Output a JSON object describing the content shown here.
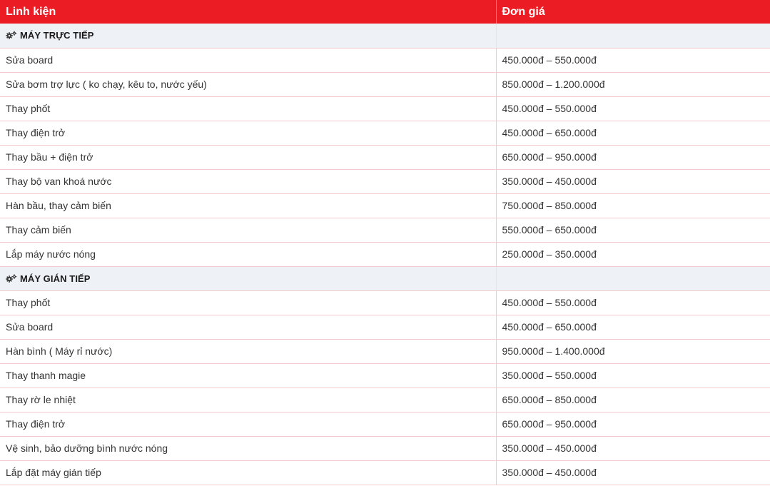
{
  "table": {
    "headers": {
      "item": "Linh kiện",
      "price": "Đơn giá"
    },
    "colors": {
      "header_bg": "#ec1c24",
      "section_bg": "#eef1f5",
      "row_border": "#f3c9cb"
    },
    "sections": [
      {
        "icon": "gears-icon",
        "title": "MÁY TRỰC TIẾP",
        "rows": [
          {
            "item": "Sửa board",
            "price": "450.000đ – 550.000đ"
          },
          {
            "item": "Sửa bơm trợ lực ( ko chạy, kêu to, nước yếu)",
            "price": "850.000đ – 1.200.000đ"
          },
          {
            "item": "Thay phốt",
            "price": "450.000đ – 550.000đ"
          },
          {
            "item": "Thay điện trở",
            "price": "450.000đ – 650.000đ"
          },
          {
            "item": "Thay bầu + điện trở",
            "price": "650.000đ – 950.000đ"
          },
          {
            "item": "Thay bộ van khoá nước",
            "price": "350.000đ – 450.000đ"
          },
          {
            "item": "Hàn bầu, thay cảm biến",
            "price": "750.000đ – 850.000đ"
          },
          {
            "item": "Thay cảm biến",
            "price": "550.000đ – 650.000đ"
          },
          {
            "item": "Lắp máy nước nóng",
            "price": "250.000đ – 350.000đ"
          }
        ]
      },
      {
        "icon": "gears-icon",
        "title": "MÁY GIÁN TIẾP",
        "rows": [
          {
            "item": "Thay phốt",
            "price": "450.000đ – 550.000đ"
          },
          {
            "item": "Sửa board",
            "price": "450.000đ – 650.000đ"
          },
          {
            "item": "Hàn bình ( Máy rỉ nước)",
            "price": "950.000đ – 1.400.000đ"
          },
          {
            "item": "Thay thanh magie",
            "price": "350.000đ – 550.000đ"
          },
          {
            "item": "Thay rờ le nhiệt",
            "price": "650.000đ – 850.000đ"
          },
          {
            "item": "Thay điện trở",
            "price": "650.000đ – 950.000đ"
          },
          {
            "item": "Vệ sinh, bảo dưỡng bình nước nóng",
            "price": "350.000đ – 450.000đ"
          },
          {
            "item": "Lắp đặt máy gián tiếp",
            "price": "350.000đ – 450.000đ"
          }
        ]
      }
    ]
  }
}
